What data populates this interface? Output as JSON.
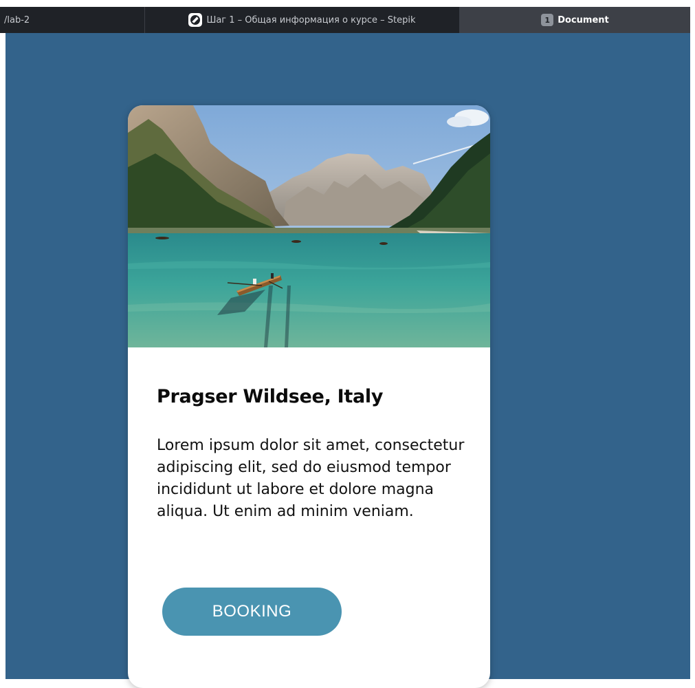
{
  "browser": {
    "tabs": [
      {
        "label": "/lab-2",
        "active": false
      },
      {
        "label": "Шаг 1 – Общая информация о курсе – Stepik",
        "active": false,
        "icon": "stepik-icon"
      },
      {
        "label": "Document",
        "active": true,
        "badge": "1"
      }
    ]
  },
  "page": {
    "background_color": "#33638b",
    "card": {
      "image": {
        "subject": "mountain-lake-with-rowboat-photo"
      },
      "title": "Pragser Wildsee, Italy",
      "text": "Lorem ipsum dolor sit amet, consectetur adipiscing elit, sed do eiusmod tempor incididunt ut labore et dolore magna aliqua. Ut enim ad minim veniam.",
      "button_label": "BOOKING",
      "button_color": "#4a94b1"
    }
  }
}
